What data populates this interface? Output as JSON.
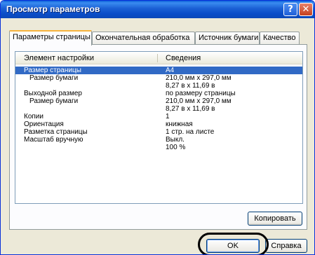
{
  "window": {
    "title": "Просмотр параметров",
    "help_glyph": "?",
    "close_glyph": "✕"
  },
  "tabs": [
    {
      "label": "Параметры страницы",
      "active": true
    },
    {
      "label": "Окончательная обработка",
      "active": false
    },
    {
      "label": "Источник бумаги",
      "active": false
    },
    {
      "label": "Качество",
      "active": false
    }
  ],
  "list": {
    "columns": [
      "Элемент настройки",
      "Сведения"
    ],
    "rows": [
      {
        "item": "Размер страницы",
        "value": "A4",
        "selected": true,
        "indent": false
      },
      {
        "item": "Размер бумаги",
        "value": "210,0 мм x 297,0 мм",
        "selected": false,
        "indent": true
      },
      {
        "item": "",
        "value": "8,27 в x 11,69 в",
        "selected": false,
        "indent": false
      },
      {
        "item": "Выходной размер",
        "value": "по размеру страницы",
        "selected": false,
        "indent": false
      },
      {
        "item": "Размер бумаги",
        "value": "210,0 мм x 297,0 мм",
        "selected": false,
        "indent": true
      },
      {
        "item": "",
        "value": "8,27 в x 11,69 в",
        "selected": false,
        "indent": false
      },
      {
        "item": "Копии",
        "value": "1",
        "selected": false,
        "indent": false
      },
      {
        "item": "Ориентация",
        "value": "книжная",
        "selected": false,
        "indent": false
      },
      {
        "item": "Разметка страницы",
        "value": "1 стр. на листе",
        "selected": false,
        "indent": false
      },
      {
        "item": "Масштаб вручную",
        "value": "Выкл.",
        "selected": false,
        "indent": false
      },
      {
        "item": "",
        "value": "100 %",
        "selected": false,
        "indent": false
      }
    ]
  },
  "buttons": {
    "copy": "Копировать",
    "ok": "OK",
    "help": "Справка"
  },
  "colors": {
    "titlebar": "#0a4dc8",
    "selection": "#316ac5",
    "tab_accent": "#f7b33d",
    "dialog_bg": "#ece9d8"
  }
}
